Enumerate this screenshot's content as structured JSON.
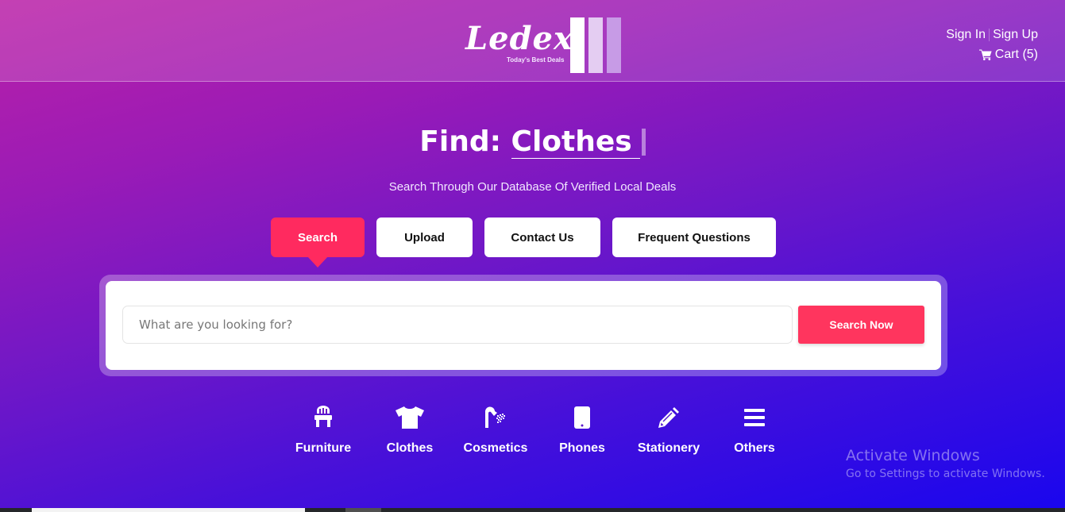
{
  "header": {
    "logo": {
      "name": "Ledex",
      "tagline": "Today's Best Deals"
    },
    "auth": {
      "sign_in": "Sign In",
      "sign_up": "Sign Up"
    },
    "cart": {
      "label": "Cart (5)",
      "icon": "shopping-cart-icon"
    }
  },
  "hero": {
    "find_prefix": "Find:",
    "find_word": "Clothes",
    "subtitle": "Search Through Our Database Of Verified Local Deals"
  },
  "tabs": [
    {
      "label": "Search",
      "active": true
    },
    {
      "label": "Upload",
      "active": false
    },
    {
      "label": "Contact Us",
      "active": false
    },
    {
      "label": "Frequent Questions",
      "active": false
    }
  ],
  "search": {
    "placeholder": "What are you looking for?",
    "value": "",
    "button": "Search Now"
  },
  "categories": [
    {
      "label": "Furniture",
      "icon": "chair-icon"
    },
    {
      "label": "Clothes",
      "icon": "tshirt-icon"
    },
    {
      "label": "Cosmetics",
      "icon": "shower-icon"
    },
    {
      "label": "Phones",
      "icon": "mobile-phone-icon"
    },
    {
      "label": "Stationery",
      "icon": "pencil-icon"
    },
    {
      "label": "Others",
      "icon": "bars-icon"
    }
  ],
  "colors": {
    "accent": "#ff2a5f",
    "search_button": "#ff355e",
    "gradient_start": "#bb21a7",
    "gradient_end": "#1a06ee"
  },
  "watermark": {
    "title": "Activate Windows",
    "subtitle": "Go to Settings to activate Windows."
  }
}
